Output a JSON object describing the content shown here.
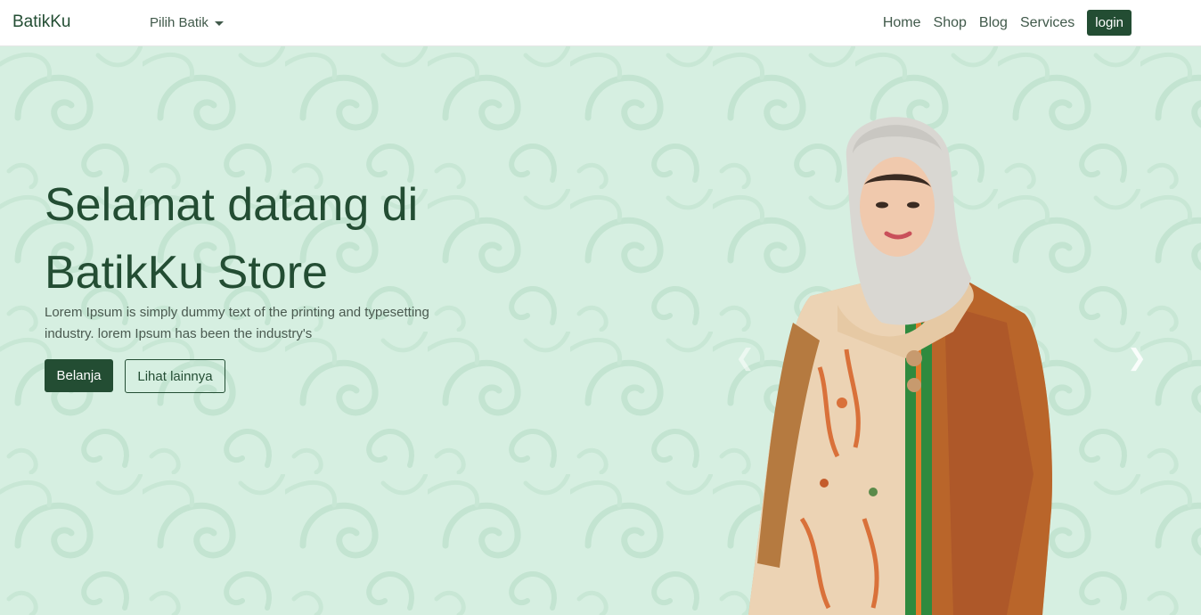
{
  "nav": {
    "brand": "BatikKu",
    "dropdown_label": "Pilih Batik",
    "links": [
      "Home",
      "Shop",
      "Blog",
      "Services"
    ],
    "login_label": "login"
  },
  "hero": {
    "title": "Selamat datang di BatikKu Store",
    "description": "Lorem Ipsum is simply dummy text of the printing and typesetting industry. lorem Ipsum has been the industry's",
    "primary_button": "Belanja",
    "secondary_button": "Lihat lainnya"
  },
  "icons": {
    "dropdown": "chevron-down-icon",
    "prev": "chevron-left-icon",
    "next": "chevron-right-icon"
  },
  "colors": {
    "brand_green": "#234d33",
    "hero_bg": "#d6efe1",
    "nav_text": "#40594a"
  }
}
